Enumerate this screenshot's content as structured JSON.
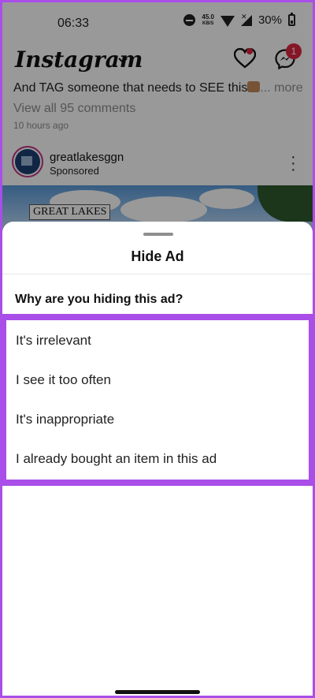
{
  "status_bar": {
    "time": "06:33",
    "net_speed_value": "45.0",
    "net_speed_unit": "KB/S",
    "battery": "30%"
  },
  "header": {
    "logo": "Instagram",
    "notification_badge": "1",
    "icons": [
      "chevron-down-icon",
      "heart-icon",
      "messenger-icon"
    ]
  },
  "feed": {
    "caption": "And TAG someone that needs to SEE this",
    "caption_more": "... more",
    "view_comments": "View all 95 comments",
    "post_time": "10 hours ago",
    "post": {
      "username": "greatlakesggn",
      "label": "Sponsored",
      "image_text": "GREAT LAKES"
    }
  },
  "sheet": {
    "title": "Hide Ad",
    "question": "Why are you hiding this ad?",
    "options": [
      "It's irrelevant",
      "I see it too often",
      "It's inappropriate",
      "I already bought an item in this ad"
    ]
  },
  "colors": {
    "highlight": "#a94ee8",
    "badge": "#e0263e",
    "overlay": "rgba(0,0,0,0.40)"
  }
}
